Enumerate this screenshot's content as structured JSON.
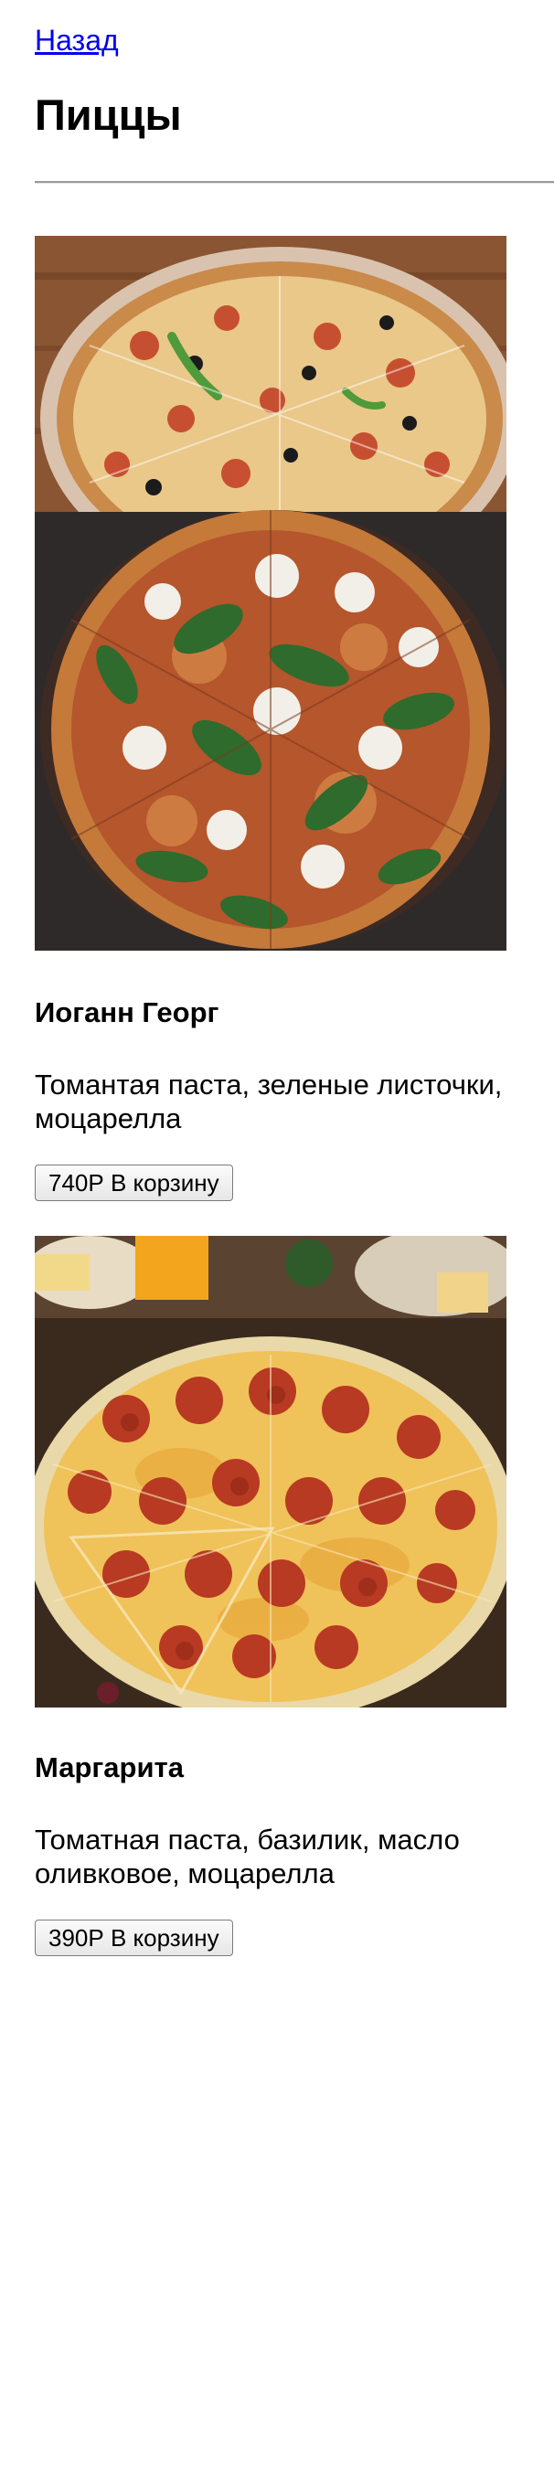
{
  "nav": {
    "back_label": "Назад"
  },
  "header": {
    "title": "Пиццы"
  },
  "pizzas": [
    {
      "image": "pizza-collage-photo",
      "name": "Иоганн Георг",
      "description": "Томантая паста, зеленые листочки, моцарелла",
      "button_label": "740Р В корзину"
    },
    {
      "image": "pepperoni-pizza-photo",
      "name": "Маргарита",
      "description": "Томатная паста, базилик, масло оливковое, моцарелла",
      "button_label": "390Р В корзину"
    }
  ],
  "colors": {
    "link": "#0000ee",
    "divider": "#9a9a9a",
    "button_border": "#7b7b7b"
  }
}
